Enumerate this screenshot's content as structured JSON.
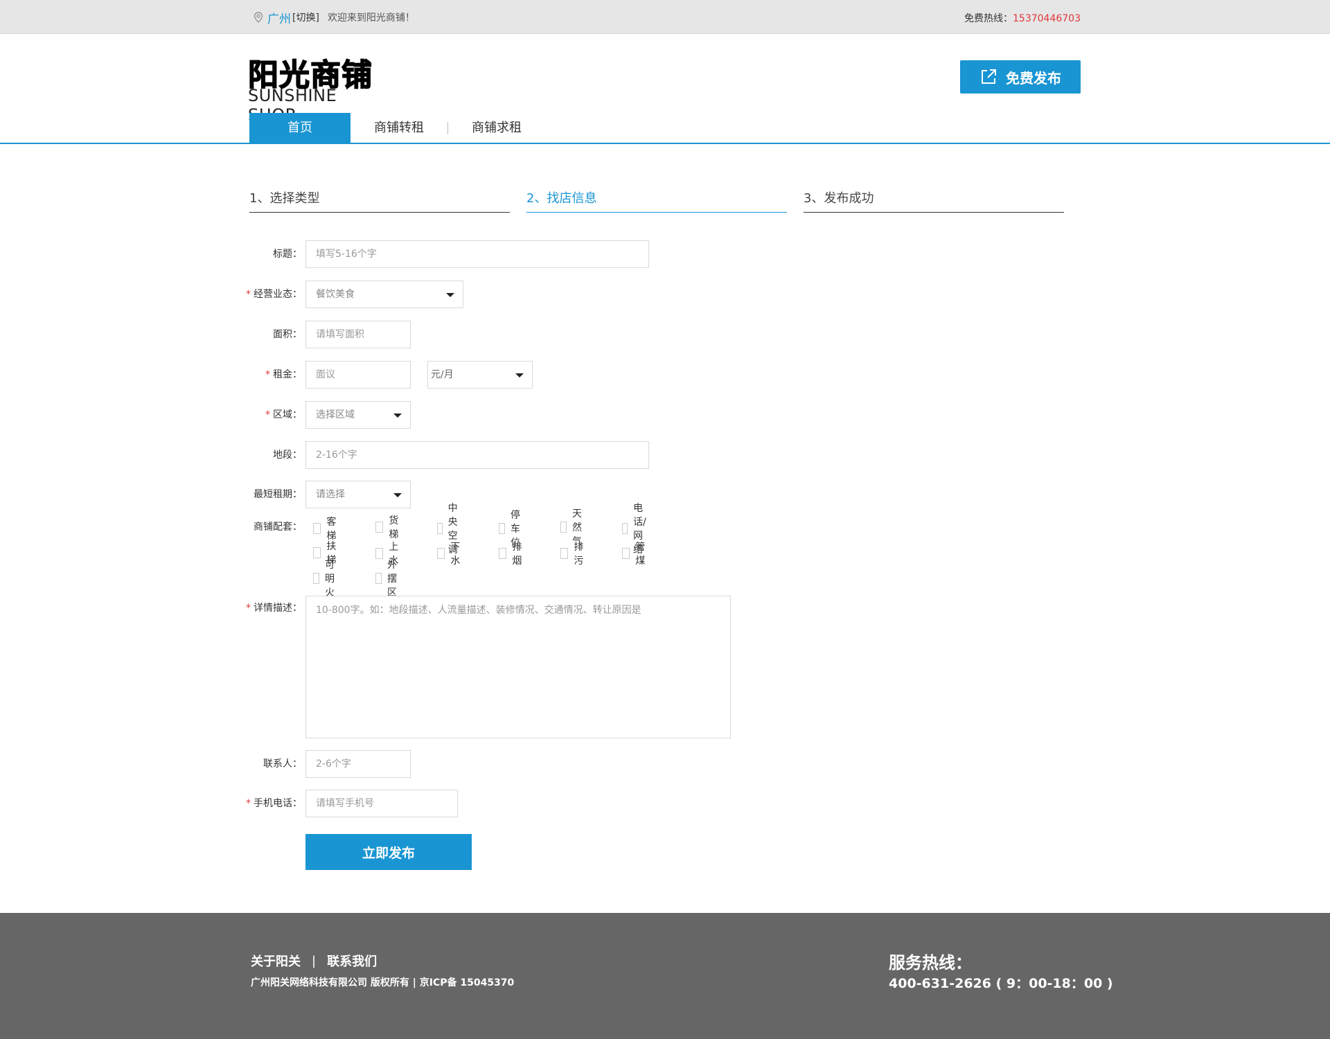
{
  "topbar": {
    "city": "广州",
    "switch": "[切换]",
    "welcome": "欢迎来到阳光商铺！",
    "hotline_label": "免费热线：",
    "hotline_number": "15370446703"
  },
  "header": {
    "logo_cn": "阳光商铺",
    "logo_en": "SUNSHINE SHOP",
    "publish_button": "免费发布"
  },
  "nav": {
    "items": [
      {
        "label": "首页",
        "active": true
      },
      {
        "label": "商铺转租",
        "active": false
      },
      {
        "label": "商铺求租",
        "active": false
      }
    ]
  },
  "steps": [
    {
      "label": "1、选择类型",
      "active": false
    },
    {
      "label": "2、找店信息",
      "active": true
    },
    {
      "label": "3、发布成功",
      "active": false
    }
  ],
  "form": {
    "title": {
      "label": "标题：",
      "placeholder": "填写5-16个字"
    },
    "business": {
      "label": "经营业态：",
      "value": "餐饮美食",
      "required": true
    },
    "area": {
      "label": "面积：",
      "placeholder": "请填写面积"
    },
    "rent": {
      "label": "租金：",
      "placeholder": "面议",
      "unit": "元/月",
      "required": true
    },
    "district": {
      "label": "区域：",
      "value": "选择区域",
      "required": true
    },
    "location": {
      "label": "地段：",
      "placeholder": "2-16个字"
    },
    "min_term": {
      "label": "最短租期：",
      "value": "请选择"
    },
    "facilities": {
      "label": "商铺配套：",
      "options": [
        "客梯",
        "货梯",
        "中央空调",
        "停车位",
        "天然气",
        "电话/网络",
        "扶梯",
        "上水",
        "下水",
        "排烟",
        "排污",
        "管煤",
        "可明火",
        "外摆区"
      ]
    },
    "description": {
      "label": "详情描述：",
      "placeholder": "10-800字。如：地段描述、人流量描述、装修情况、交通情况、转让原因是",
      "required": true
    },
    "contact": {
      "label": "联系人：",
      "placeholder": "2-6个字"
    },
    "phone": {
      "label": "手机电话：",
      "placeholder": "请填写手机号",
      "required": true
    },
    "required_mark": "*",
    "submit": "立即发布"
  },
  "footer": {
    "about": "关于阳关",
    "separator": "|",
    "contact": "联系我们",
    "copyright": "广州阳关网络科技有限公司 版权所有 | 京ICP备 15045370",
    "service_title": "服务热线：",
    "service_number": "400-631-2626 ( 9：00-18：00 )"
  },
  "colors": {
    "accent": "#1a95d3",
    "hotline": "#e0373a",
    "footer_bg": "#666666",
    "topbar_bg": "#e6e6e6"
  },
  "icons": {
    "location": "location-pin-icon",
    "publish": "external-link-icon",
    "select": "chevron-down-icon"
  }
}
